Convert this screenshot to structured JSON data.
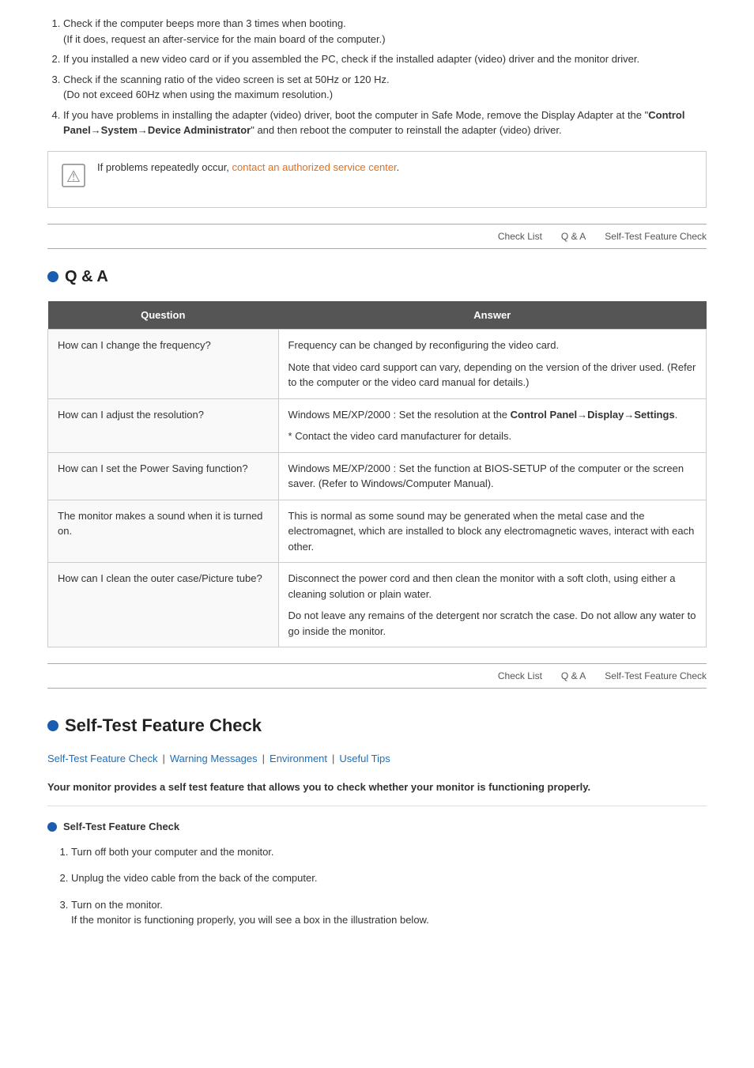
{
  "top_section": {
    "items": [
      {
        "text": "Check if the computer beeps more than 3 times when booting.\n(If it does, request an after-service for the main board of the computer.)"
      },
      {
        "text": "If you installed a new video card or if you assembled the PC, check if the installed adapter (video) driver and the monitor driver."
      },
      {
        "text": "Check if the scanning ratio of the video screen is set at 50Hz or 120 Hz.\n(Do not exceed 60Hz when using the maximum resolution.)"
      },
      {
        "text": "If you have problems in installing the adapter (video) driver, boot the computer in Safe Mode, remove the Display Adapter at the \"Control Panel→System→Device Administrator\" and then reboot the computer to reinstall the adapter (video) driver."
      }
    ],
    "notice": {
      "text": "If problems repeatedly occur, ",
      "link_text": "contact an authorized service center",
      "link_href": "#"
    }
  },
  "nav1": {
    "items": [
      "Check List",
      "Q & A",
      "Self-Test Feature Check"
    ]
  },
  "qa_section": {
    "heading": "Q & A",
    "table": {
      "col1": "Question",
      "col2": "Answer",
      "rows": [
        {
          "question": "How can I change the frequency?",
          "answer": [
            "Frequency can be changed by reconfiguring the video card.",
            "Note that video card support can vary, depending on the version of the driver used. (Refer to the computer or the video card manual for details.)"
          ]
        },
        {
          "question": "How can I adjust the resolution?",
          "answer": [
            "Windows ME/XP/2000 : Set the resolution at the Control Panel→Display→Settings.",
            "* Contact the video card manufacturer for details."
          ]
        },
        {
          "question": "How can I set the Power Saving function?",
          "answer": [
            "Windows ME/XP/2000 : Set the function at BIOS-SETUP of the computer or the screen saver. (Refer to Windows/Computer Manual)."
          ]
        },
        {
          "question": "The monitor makes a sound when it is turned on.",
          "answer": [
            "This is normal as some sound may be generated when the metal case and the electromagnet, which are installed to block any electromagnetic waves, interact with each other."
          ]
        },
        {
          "question": "How can I clean the outer case/Picture tube?",
          "answer": [
            "Disconnect the power cord and then clean the monitor with a soft cloth, using either a cleaning solution or plain water.",
            "Do not leave any remains of the detergent nor scratch the case. Do not allow any water to go inside the monitor."
          ]
        }
      ]
    }
  },
  "nav2": {
    "items": [
      "Check List",
      "Q & A",
      "Self-Test Feature Check"
    ]
  },
  "self_test_section": {
    "heading": "Self-Test Feature Check",
    "sub_links": [
      "Self-Test Feature Check",
      "Warning Messages",
      "Environment",
      "Useful Tips"
    ],
    "intro": "Your monitor provides a self test feature that allows you to check whether your monitor is functioning properly.",
    "sub_heading": "Self-Test Feature Check",
    "steps": [
      {
        "text": "Turn off both your computer and the monitor."
      },
      {
        "text": "Unplug the video cable from the back of the computer."
      },
      {
        "text": "Turn on the monitor.\nIf the monitor is functioning properly, you will see a box in the illustration below."
      }
    ]
  }
}
